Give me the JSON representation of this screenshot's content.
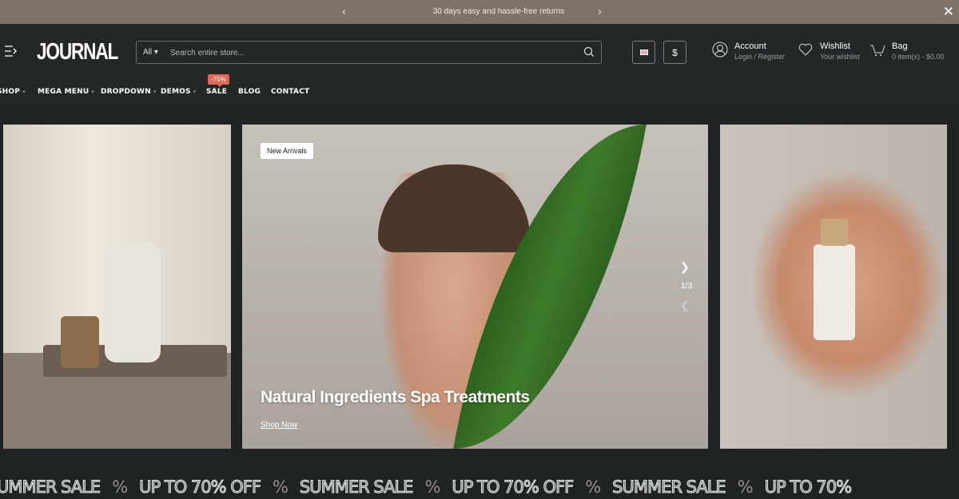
{
  "topbar": {
    "message": "30 days easy and hassle-free returns",
    "prev_icon": "chevron-left",
    "next_icon": "chevron-right",
    "close_icon": "close"
  },
  "header": {
    "logo": "JOURNAL",
    "search": {
      "category": "All",
      "placeholder": "Search entire store..."
    },
    "currency": "$",
    "account": {
      "title": "Account",
      "subtitle": "Login / Register"
    },
    "wishlist": {
      "title": "Wishlist",
      "subtitle": "Your wishlist"
    },
    "bag": {
      "title": "Bag",
      "subtitle": "0 item(s) - $0.00"
    }
  },
  "nav": {
    "items": [
      {
        "label": "SHOP"
      },
      {
        "label": "MEGA MENU"
      },
      {
        "label": "DROPDOWN"
      },
      {
        "label": "DEMOS"
      },
      {
        "label": "SALE"
      },
      {
        "label": "BLOG"
      },
      {
        "label": "CONTACT"
      }
    ],
    "sale_badge": "-75%"
  },
  "slider": {
    "tag": "New Arrivals",
    "headline": "Natural Ingredients Spa Treatments",
    "cta": "Shop Now",
    "pager": "1/3"
  },
  "marquee": {
    "items": [
      "UMMER SALE",
      "%",
      "UP TO 70% OFF",
      "%",
      "SUMMER SALE",
      "%",
      "UP TO 70% OFF",
      "%",
      "SUMMER SALE",
      "%",
      "UP TO 70%"
    ]
  },
  "colors": {
    "topbar": "#7f7268",
    "header": "#232728",
    "badge": "#e2665a"
  }
}
